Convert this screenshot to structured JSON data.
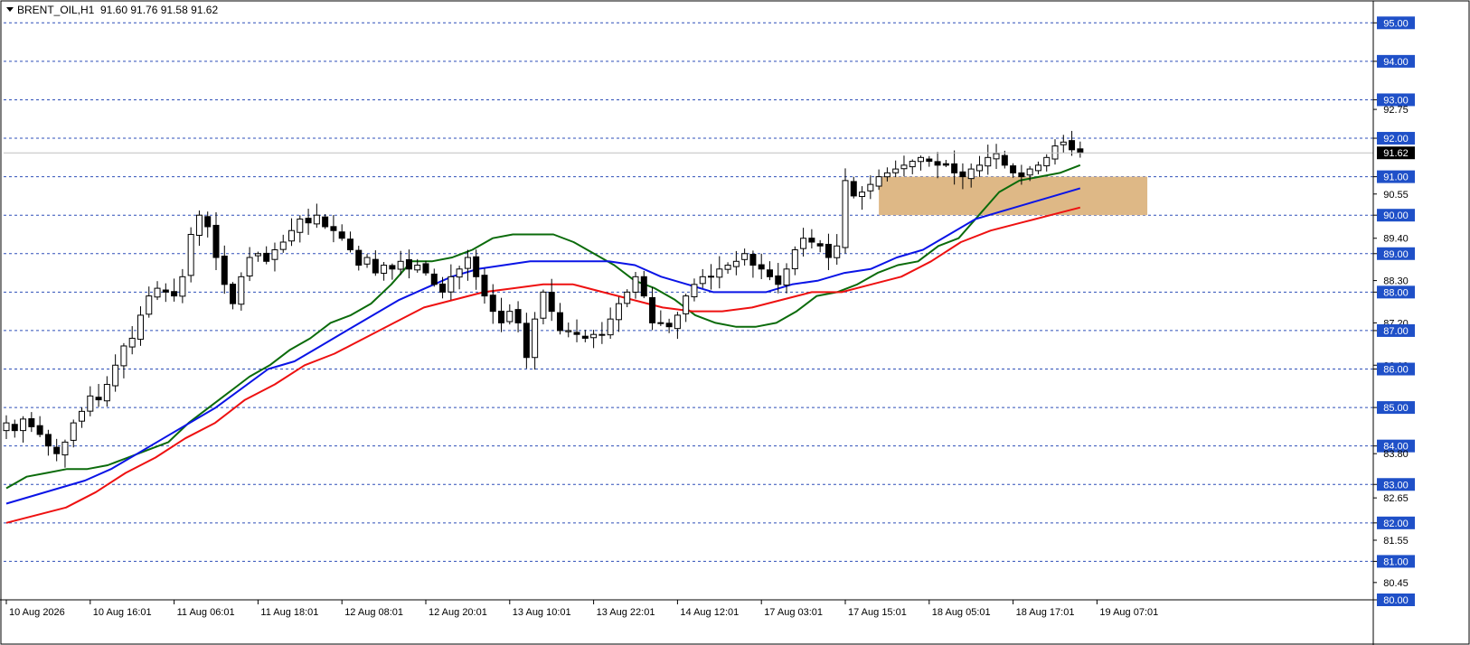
{
  "header": {
    "symbol": "BRENT_OIL,H1",
    "ohlc": "91.60 91.76 91.58 91.62"
  },
  "colors": {
    "background": "#ffffff",
    "grid": "#2e4fb8",
    "bull_body": "#ffffff",
    "bear_body": "#000000",
    "wick": "#000000",
    "ma_fast": "#0b6b0b",
    "ma_mid": "#0a14e6",
    "ma_slow": "#ee1111",
    "zone_fill": "#deb886",
    "level_bg": "#1f50c8",
    "price_bg": "#000000"
  },
  "chart_data": {
    "type": "candlestick",
    "symbol": "BRENT_OIL",
    "timeframe": "H1",
    "y_axis": {
      "min": 80.0,
      "max": 95.5,
      "ticks": [
        {
          "v": 95.0,
          "label": "95.00",
          "boxed": true
        },
        {
          "v": 94.0,
          "label": "94.00",
          "boxed": true
        },
        {
          "v": 93.0,
          "label": "93.00",
          "boxed": true
        },
        {
          "v": 92.75,
          "label": "92.75",
          "boxed": false
        },
        {
          "v": 92.0,
          "label": "92.00",
          "boxed": true
        },
        {
          "v": 91.0,
          "label": "91.00",
          "boxed": true
        },
        {
          "v": 90.55,
          "label": "90.55",
          "boxed": false
        },
        {
          "v": 90.0,
          "label": "90.00",
          "boxed": true
        },
        {
          "v": 89.4,
          "label": "89.40",
          "boxed": false
        },
        {
          "v": 89.0,
          "label": "89.00",
          "boxed": true
        },
        {
          "v": 88.3,
          "label": "88.30",
          "boxed": false
        },
        {
          "v": 88.0,
          "label": "88.00",
          "boxed": true
        },
        {
          "v": 87.2,
          "label": "87.20",
          "boxed": false
        },
        {
          "v": 87.0,
          "label": "87.00",
          "boxed": true
        },
        {
          "v": 86.1,
          "label": "86.10",
          "boxed": false
        },
        {
          "v": 86.0,
          "label": "86.00",
          "boxed": true
        },
        {
          "v": 85.0,
          "label": "85.00",
          "boxed": true
        },
        {
          "v": 84.0,
          "label": "84.00",
          "boxed": true
        },
        {
          "v": 83.8,
          "label": "83.80",
          "boxed": false
        },
        {
          "v": 83.0,
          "label": "83.00",
          "boxed": true
        },
        {
          "v": 82.65,
          "label": "82.65",
          "boxed": false
        },
        {
          "v": 82.0,
          "label": "82.00",
          "boxed": true
        },
        {
          "v": 81.55,
          "label": "81.55",
          "boxed": false
        },
        {
          "v": 81.0,
          "label": "81.00",
          "boxed": true
        },
        {
          "v": 80.45,
          "label": "80.45",
          "boxed": false
        },
        {
          "v": 80.0,
          "label": "80.00",
          "boxed": true
        }
      ],
      "grid_levels": [
        95,
        94,
        93,
        92,
        91,
        90,
        89,
        88,
        87,
        86,
        85,
        84,
        83,
        82,
        81
      ]
    },
    "x_axis": {
      "labels": [
        {
          "i": 0,
          "label": "10 Aug 2026"
        },
        {
          "i": 10,
          "label": "10 Aug 16:01"
        },
        {
          "i": 20,
          "label": "11 Aug 06:01"
        },
        {
          "i": 30,
          "label": "11 Aug 18:01"
        },
        {
          "i": 40,
          "label": "12 Aug 08:01"
        },
        {
          "i": 50,
          "label": "12 Aug 20:01"
        },
        {
          "i": 60,
          "label": "13 Aug 10:01"
        },
        {
          "i": 70,
          "label": "13 Aug 22:01"
        },
        {
          "i": 80,
          "label": "14 Aug 12:01"
        },
        {
          "i": 90,
          "label": "17 Aug 03:01"
        },
        {
          "i": 100,
          "label": "17 Aug 15:01"
        },
        {
          "i": 110,
          "label": "18 Aug 05:01"
        },
        {
          "i": 120,
          "label": "18 Aug 17:01"
        },
        {
          "i": 130,
          "label": "19 Aug 07:01"
        }
      ]
    },
    "current_price": {
      "value": 91.62,
      "label": "91.62"
    },
    "zone": {
      "from_index": 104,
      "to_index": 136,
      "low": 90.0,
      "high": 91.0
    },
    "closes": [
      84.6,
      84.4,
      84.7,
      84.5,
      84.3,
      84.0,
      83.8,
      84.1,
      84.6,
      84.9,
      85.3,
      85.2,
      85.6,
      86.1,
      86.6,
      86.8,
      87.4,
      87.9,
      88.1,
      88.0,
      87.9,
      88.4,
      89.5,
      90.0,
      89.7,
      88.9,
      88.2,
      87.7,
      88.4,
      88.9,
      89.0,
      88.8,
      89.1,
      89.3,
      89.6,
      89.9,
      89.8,
      90.0,
      89.7,
      89.6,
      89.4,
      89.1,
      88.7,
      88.9,
      88.5,
      88.7,
      88.6,
      88.8,
      88.6,
      88.7,
      88.5,
      88.2,
      88.0,
      88.4,
      88.6,
      88.9,
      88.4,
      87.9,
      87.5,
      87.2,
      87.5,
      87.2,
      86.3,
      87.3,
      88.0,
      87.5,
      87.0,
      87.0,
      86.9,
      86.8,
      86.9,
      86.9,
      87.3,
      87.7,
      88.0,
      88.4,
      87.9,
      87.2,
      87.2,
      87.1,
      87.4,
      87.9,
      88.2,
      88.4,
      88.4,
      88.6,
      88.7,
      88.8,
      89.0,
      88.7,
      88.6,
      88.4,
      88.2,
      88.6,
      89.1,
      89.4,
      89.3,
      89.2,
      88.9,
      89.2,
      90.9,
      90.5,
      90.6,
      90.8,
      91.0,
      91.1,
      91.2,
      91.3,
      91.4,
      91.5,
      91.4,
      91.3,
      91.3,
      91.1,
      91.0,
      91.2,
      91.3,
      91.5,
      91.6,
      91.3,
      91.1,
      91.0,
      91.2,
      91.3,
      91.5,
      91.8,
      91.9,
      91.7,
      91.62
    ],
    "series": [
      {
        "name": "MA fast",
        "color": "#0b6b0b",
        "values": [
          82.9,
          83.2,
          83.3,
          83.4,
          83.4,
          83.5,
          83.7,
          83.9,
          84.1,
          84.6,
          85.0,
          85.4,
          85.8,
          86.1,
          86.5,
          86.8,
          87.2,
          87.4,
          87.7,
          88.2,
          88.8,
          88.8,
          88.9,
          89.1,
          89.4,
          89.5,
          89.5,
          89.5,
          89.3,
          89.0,
          88.7,
          88.3,
          88.1,
          87.8,
          87.4,
          87.2,
          87.1,
          87.1,
          87.2,
          87.5,
          87.9,
          88.0,
          88.2,
          88.5,
          88.7,
          88.8,
          89.2,
          89.4,
          90.0,
          90.6,
          90.9,
          91.0,
          91.1,
          91.3
        ]
      },
      {
        "name": "MA mid",
        "color": "#0a14e6",
        "values": [
          82.5,
          82.7,
          82.9,
          83.1,
          83.4,
          83.8,
          84.2,
          84.6,
          85.0,
          85.5,
          86.0,
          86.2,
          86.6,
          87.0,
          87.4,
          87.8,
          88.1,
          88.4,
          88.6,
          88.7,
          88.8,
          88.8,
          88.8,
          88.8,
          88.7,
          88.4,
          88.2,
          88.0,
          88.0,
          88.0,
          88.2,
          88.3,
          88.5,
          88.6,
          88.9,
          89.1,
          89.5,
          89.9,
          90.1,
          90.3,
          90.5,
          90.7
        ]
      },
      {
        "name": "MA slow",
        "color": "#ee1111",
        "values": [
          82.0,
          82.2,
          82.4,
          82.8,
          83.3,
          83.7,
          84.2,
          84.6,
          85.2,
          85.6,
          86.1,
          86.4,
          86.8,
          87.2,
          87.6,
          87.8,
          88.0,
          88.1,
          88.2,
          88.2,
          88.0,
          87.8,
          87.6,
          87.5,
          87.5,
          87.6,
          87.8,
          88.0,
          88.0,
          88.2,
          88.4,
          88.8,
          89.3,
          89.6,
          89.8,
          90.0,
          90.2
        ]
      }
    ]
  }
}
